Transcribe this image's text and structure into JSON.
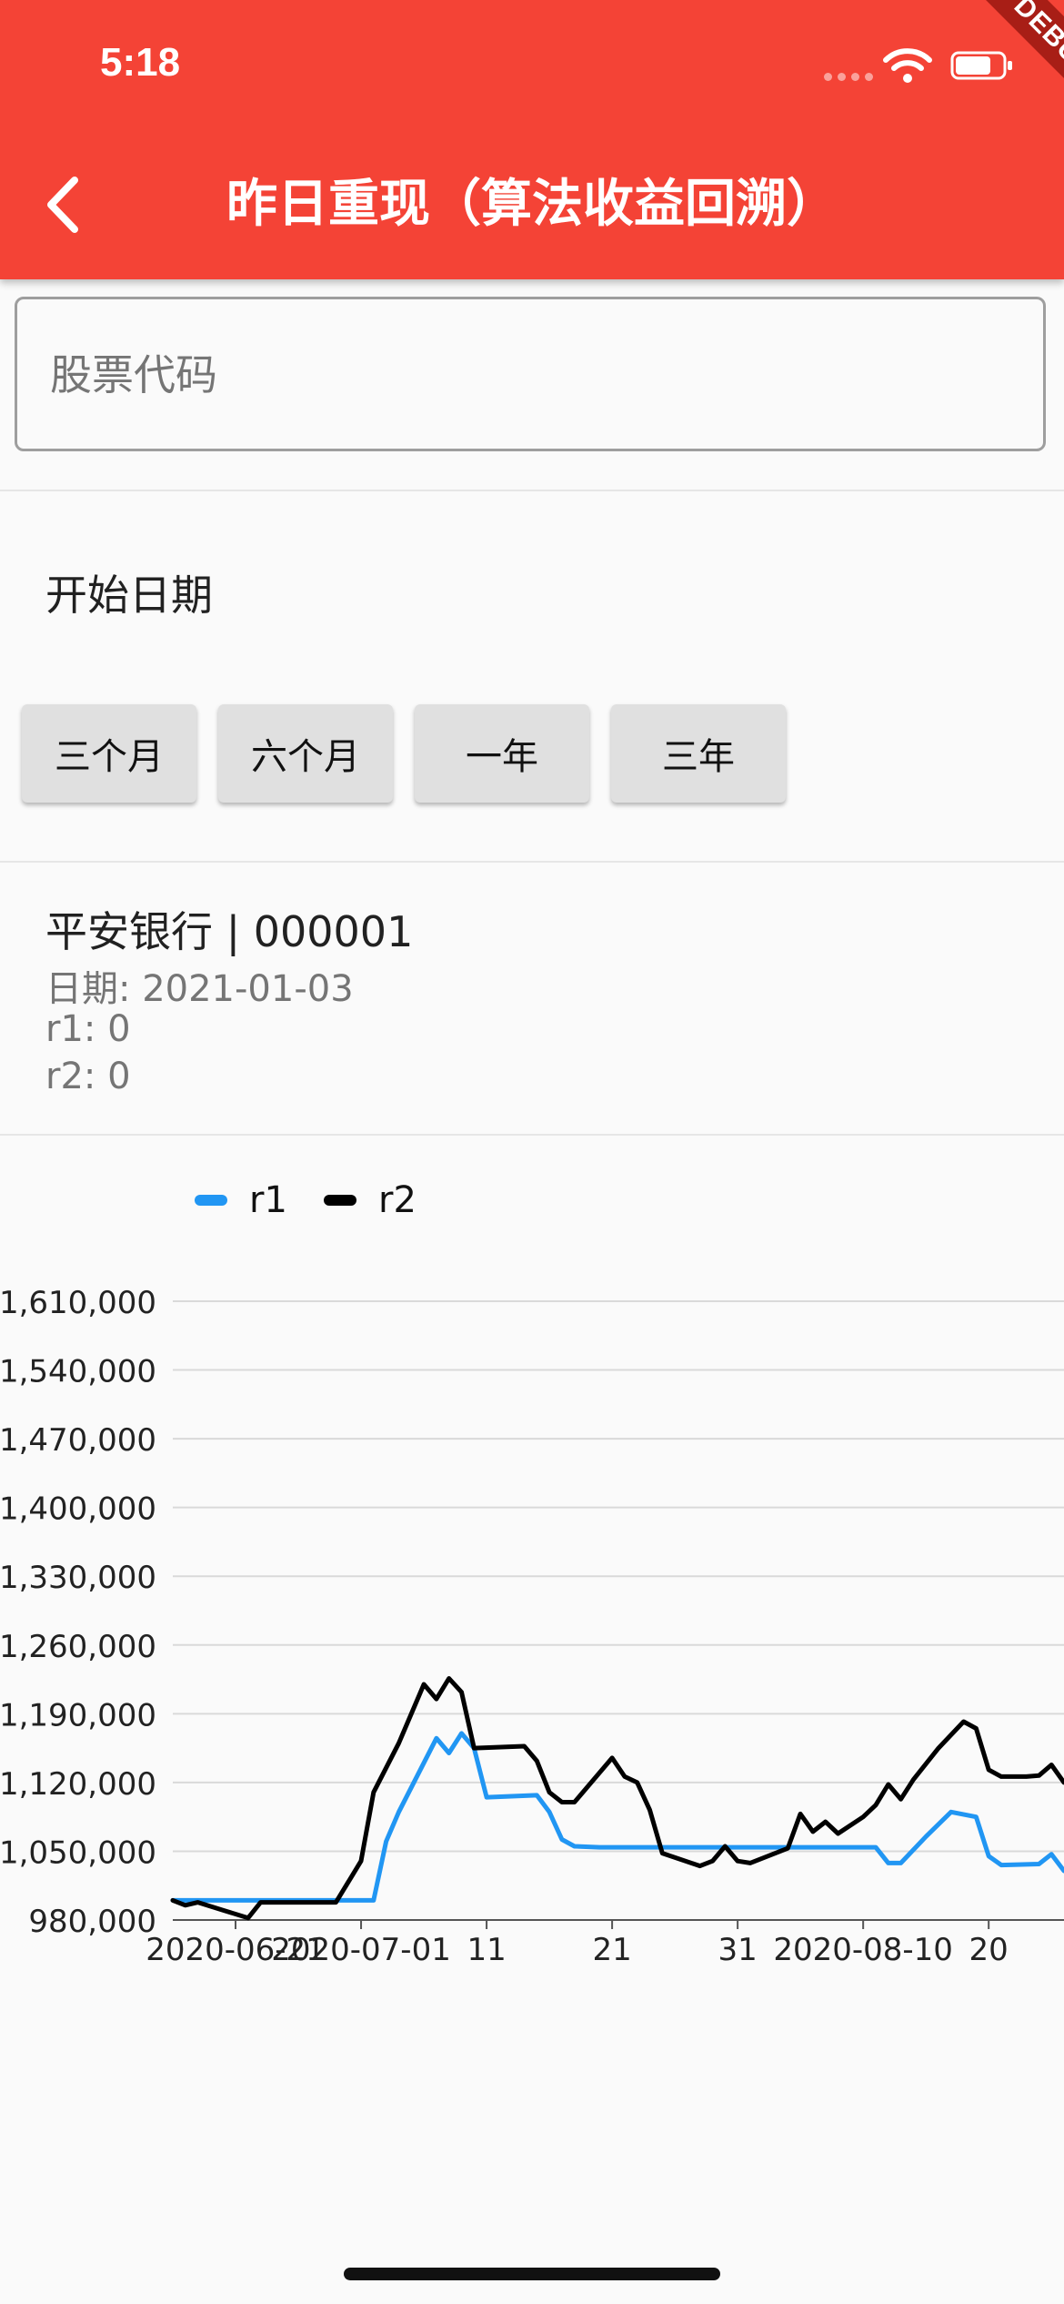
{
  "status_bar": {
    "time": "5:18"
  },
  "debug_banner": "DEBUG",
  "app_bar": {
    "title": "昨日重现（算法收益回溯）"
  },
  "stock_input": {
    "placeholder": "股票代码",
    "value": ""
  },
  "date_section": {
    "label": "开始日期"
  },
  "range_buttons": [
    "三个月",
    "六个月",
    "一年",
    "三年"
  ],
  "stock_info": {
    "title": "平安银行 | 000001",
    "date": "日期: 2021-01-03",
    "r1": "r1: 0",
    "r2": "r2: 0"
  },
  "colors": {
    "r1": "#2196f3",
    "r2": "#000000",
    "app_bar": "#f44336"
  },
  "chart_data": {
    "type": "line",
    "legend": [
      "r1",
      "r2"
    ],
    "legend_position": "top-left",
    "ylim": [
      980000,
      1610000
    ],
    "y_ticks": [
      {
        "value": 980000,
        "label": "980,000"
      },
      {
        "value": 1050000,
        "label": "1,050,000"
      },
      {
        "value": 1120000,
        "label": "1,120,000"
      },
      {
        "value": 1190000,
        "label": "1,190,000"
      },
      {
        "value": 1260000,
        "label": "1,260,000"
      },
      {
        "value": 1330000,
        "label": "1,330,000"
      },
      {
        "value": 1400000,
        "label": "1,400,000"
      },
      {
        "value": 1470000,
        "label": "1,470,000"
      },
      {
        "value": 1540000,
        "label": "1,540,000"
      },
      {
        "value": 1610000,
        "label": "1,610,000"
      }
    ],
    "x_ticks": [
      {
        "date": "2020-06-21",
        "label": "2020-06-21"
      },
      {
        "date": "2020-07-01",
        "label": "2020-07-01"
      },
      {
        "date": "2020-07-11",
        "label": "11"
      },
      {
        "date": "2020-07-21",
        "label": "21"
      },
      {
        "date": "2020-07-31",
        "label": "31"
      },
      {
        "date": "2020-08-10",
        "label": "2020-08-10"
      },
      {
        "date": "2020-08-20",
        "label": "20"
      }
    ],
    "x_range": [
      "2020-06-16",
      "2020-08-26"
    ],
    "grid": true,
    "series": [
      {
        "name": "r1",
        "points": [
          [
            "2020-06-16",
            1000000
          ],
          [
            "2020-06-19",
            1000000
          ],
          [
            "2020-06-24",
            1000000
          ],
          [
            "2020-06-29",
            1000000
          ],
          [
            "2020-07-02",
            1000000
          ],
          [
            "2020-07-03",
            1060000
          ],
          [
            "2020-07-04",
            1090000
          ],
          [
            "2020-07-06",
            1140000
          ],
          [
            "2020-07-07",
            1165000
          ],
          [
            "2020-07-08",
            1150000
          ],
          [
            "2020-07-09",
            1170000
          ],
          [
            "2020-07-10",
            1155000
          ],
          [
            "2020-07-11",
            1105000
          ],
          [
            "2020-07-15",
            1107000
          ],
          [
            "2020-07-16",
            1090000
          ],
          [
            "2020-07-17",
            1062000
          ],
          [
            "2020-07-18",
            1055000
          ],
          [
            "2020-07-20",
            1054000
          ],
          [
            "2020-07-23",
            1054000
          ],
          [
            "2020-07-28",
            1054000
          ],
          [
            "2020-08-02",
            1054000
          ],
          [
            "2020-08-07",
            1054000
          ],
          [
            "2020-08-11",
            1054000
          ],
          [
            "2020-08-12",
            1038000
          ],
          [
            "2020-08-13",
            1038000
          ],
          [
            "2020-08-15",
            1065000
          ],
          [
            "2020-08-17",
            1090000
          ],
          [
            "2020-08-19",
            1085000
          ],
          [
            "2020-08-20",
            1045000
          ],
          [
            "2020-08-21",
            1036000
          ],
          [
            "2020-08-24",
            1037000
          ],
          [
            "2020-08-25",
            1047000
          ],
          [
            "2020-08-26",
            1030000
          ]
        ]
      },
      {
        "name": "r2",
        "points": [
          [
            "2020-06-16",
            1000000
          ],
          [
            "2020-06-17",
            995000
          ],
          [
            "2020-06-18",
            998000
          ],
          [
            "2020-06-20",
            990000
          ],
          [
            "2020-06-22",
            982000
          ],
          [
            "2020-06-23",
            998000
          ],
          [
            "2020-06-26",
            998000
          ],
          [
            "2020-06-29",
            998000
          ],
          [
            "2020-07-01",
            1040000
          ],
          [
            "2020-07-02",
            1110000
          ],
          [
            "2020-07-04",
            1160000
          ],
          [
            "2020-07-06",
            1220000
          ],
          [
            "2020-07-07",
            1205000
          ],
          [
            "2020-07-08",
            1226000
          ],
          [
            "2020-07-09",
            1212000
          ],
          [
            "2020-07-10",
            1155000
          ],
          [
            "2020-07-14",
            1157000
          ],
          [
            "2020-07-15",
            1142000
          ],
          [
            "2020-07-16",
            1110000
          ],
          [
            "2020-07-17",
            1100000
          ],
          [
            "2020-07-18",
            1100000
          ],
          [
            "2020-07-21",
            1145000
          ],
          [
            "2020-07-22",
            1126000
          ],
          [
            "2020-07-23",
            1120000
          ],
          [
            "2020-07-24",
            1092000
          ],
          [
            "2020-07-25",
            1048000
          ],
          [
            "2020-07-28",
            1035000
          ],
          [
            "2020-07-29",
            1040000
          ],
          [
            "2020-07-30",
            1055000
          ],
          [
            "2020-07-31",
            1040000
          ],
          [
            "2020-08-01",
            1038000
          ],
          [
            "2020-08-04",
            1053000
          ],
          [
            "2020-08-05",
            1088000
          ],
          [
            "2020-08-06",
            1070000
          ],
          [
            "2020-08-07",
            1080000
          ],
          [
            "2020-08-08",
            1068000
          ],
          [
            "2020-08-10",
            1085000
          ],
          [
            "2020-08-11",
            1097000
          ],
          [
            "2020-08-12",
            1118000
          ],
          [
            "2020-08-13",
            1103000
          ],
          [
            "2020-08-14",
            1123000
          ],
          [
            "2020-08-16",
            1155000
          ],
          [
            "2020-08-18",
            1182000
          ],
          [
            "2020-08-19",
            1175000
          ],
          [
            "2020-08-20",
            1133000
          ],
          [
            "2020-08-21",
            1126000
          ],
          [
            "2020-08-23",
            1126000
          ],
          [
            "2020-08-24",
            1127000
          ],
          [
            "2020-08-25",
            1138000
          ],
          [
            "2020-08-26",
            1120000
          ]
        ]
      }
    ]
  }
}
